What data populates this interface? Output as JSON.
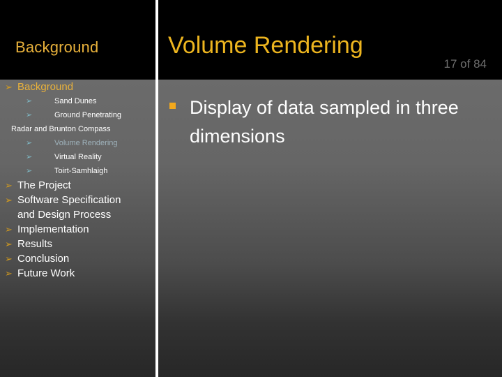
{
  "header": {
    "section_label": "Background",
    "title": "Volume Rendering",
    "counter": "17 of 84"
  },
  "sidebar": {
    "items": [
      {
        "level": 1,
        "label": "Background",
        "bullet": "arrow-bullet-gold",
        "state": "accent"
      },
      {
        "level": 2,
        "label": "Sand Dunes",
        "bullet": "arrow-bullet-blue",
        "state": "normal"
      },
      {
        "level": 2,
        "label": "Ground Penetrating",
        "bullet": "arrow-bullet-blue",
        "state": "normal"
      },
      {
        "level": 2,
        "label": "Radar  and Brunton Compass",
        "bullet": "none",
        "state": "continuation"
      },
      {
        "level": 2,
        "label": "Volume Rendering",
        "bullet": "arrow-bullet-blue",
        "state": "current"
      },
      {
        "level": 2,
        "label": "Virtual Reality",
        "bullet": "arrow-bullet-blue",
        "state": "normal"
      },
      {
        "level": 2,
        "label": "Toirt-Samhlaigh",
        "bullet": "arrow-bullet-blue",
        "state": "normal"
      },
      {
        "level": 1,
        "label": "The Project",
        "bullet": "arrow-bullet-gold",
        "state": "normal"
      },
      {
        "level": 1,
        "label": "Software Specification",
        "bullet": "arrow-bullet-gold",
        "state": "normal"
      },
      {
        "level": 1,
        "label": "and Design Process",
        "bullet": "none",
        "state": "continuation"
      },
      {
        "level": 1,
        "label": "Implementation",
        "bullet": "arrow-bullet-gold",
        "state": "normal"
      },
      {
        "level": 1,
        "label": "Results",
        "bullet": "arrow-bullet-gold",
        "state": "normal"
      },
      {
        "level": 1,
        "label": "Conclusion",
        "bullet": "arrow-bullet-gold",
        "state": "normal"
      },
      {
        "level": 1,
        "label": "Future Work",
        "bullet": "arrow-bullet-gold",
        "state": "normal"
      }
    ]
  },
  "main": {
    "bullets": [
      {
        "text": "Display of data sampled in three dimensions",
        "marker": "square-bullet"
      }
    ]
  },
  "glyphs": {
    "arrow_bullet": "➢",
    "square_bullet": ""
  },
  "colors": {
    "title_gold": "#EDB51F",
    "section_gold": "#E8B13B",
    "bullet_gold": "#D39B1E",
    "bullet_blue": "#7FB8C4",
    "current_item": "#9FB3BC",
    "content_marker": "#F2A81C",
    "counter_gray": "#6F6F6F",
    "header_black": "#000000",
    "divider_white": "#FFFFFF"
  }
}
